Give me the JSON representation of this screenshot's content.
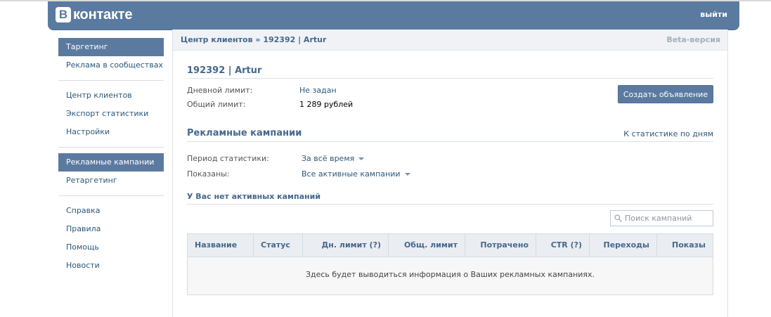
{
  "header": {
    "logo_mark": "В",
    "logo_text": "контакте",
    "logout": "выйти"
  },
  "sidebar": {
    "items": [
      {
        "label": "Таргетинг"
      },
      {
        "label": "Реклама в сообществах"
      },
      {
        "label": "Центр клиентов"
      },
      {
        "label": "Экспорт статистики"
      },
      {
        "label": "Настройки"
      },
      {
        "label": "Рекламные кампании"
      },
      {
        "label": "Ретаргетинг"
      },
      {
        "label": "Справка"
      },
      {
        "label": "Правила"
      },
      {
        "label": "Помощь"
      },
      {
        "label": "Новости"
      }
    ]
  },
  "breadcrumb": {
    "root": "Центр клиентов",
    "separator": "»",
    "current": "192392 | Artur",
    "beta": "Beta-версия"
  },
  "account": {
    "title": "192392 | Artur",
    "daily_limit_label": "Дневной лимит:",
    "daily_limit_value": "Не задан",
    "total_limit_label": "Общий лимит:",
    "total_limit_value": "1 289 рублей",
    "create_button": "Создать объявление"
  },
  "campaigns": {
    "title": "Рекламные кампании",
    "stats_link": "К статистике по дням",
    "period_label": "Период статистики:",
    "period_value": "За всё время",
    "shown_label": "Показаны:",
    "shown_value": "Все активные кампании",
    "no_active": "У Вас нет активных кампаний",
    "search_placeholder": "Поиск кампаний",
    "columns": [
      "Название",
      "Статус",
      "Дн. лимит (?)",
      "Общ. лимит",
      "Потрачено",
      "CTR (?)",
      "Переходы",
      "Показы"
    ],
    "empty_message": "Здесь будет выводиться информация о Ваших рекламных кампаниях."
  },
  "colors": {
    "brand": "#5b7aa0",
    "link": "#2b587a",
    "heading": "#45688e"
  }
}
